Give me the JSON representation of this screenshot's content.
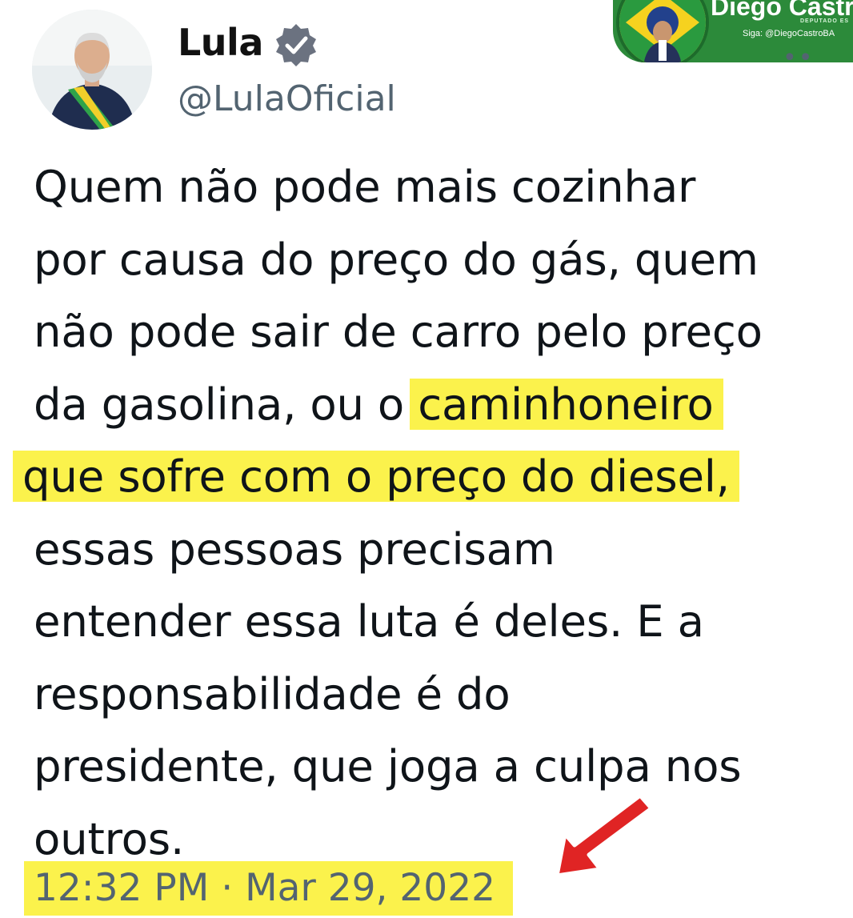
{
  "tweet": {
    "author": {
      "name": "Lula",
      "handle": "@LulaOficial",
      "verified_icon": "verified-badge-icon"
    },
    "text_lines": [
      "Quem não pode mais cozinhar",
      "por causa do preço do gás, quem",
      "não pode sair de carro pelo preço",
      "da gasolina, ou o ",
      "caminhoneiro",
      "que sofre com o preço do diesel,",
      "essas pessoas precisam",
      "entender essa luta é deles. E a",
      "responsabilidade é do",
      "presidente, que joga a culpa nos",
      "outros."
    ],
    "timestamp": "12:32 PM · Mar 29, 2022",
    "more_icon": "more-options-icon"
  },
  "watermark": {
    "name": "Diego Castro",
    "subtitle": "DEPUTADO ES",
    "follow": "Siga: @DiegoCastroBA"
  },
  "colors": {
    "highlight": "#fbf24c",
    "handle_gray": "#536471",
    "verified_gray": "#6b7280",
    "arrow_red": "#e02424",
    "watermark_green": "#2c8a3a"
  }
}
